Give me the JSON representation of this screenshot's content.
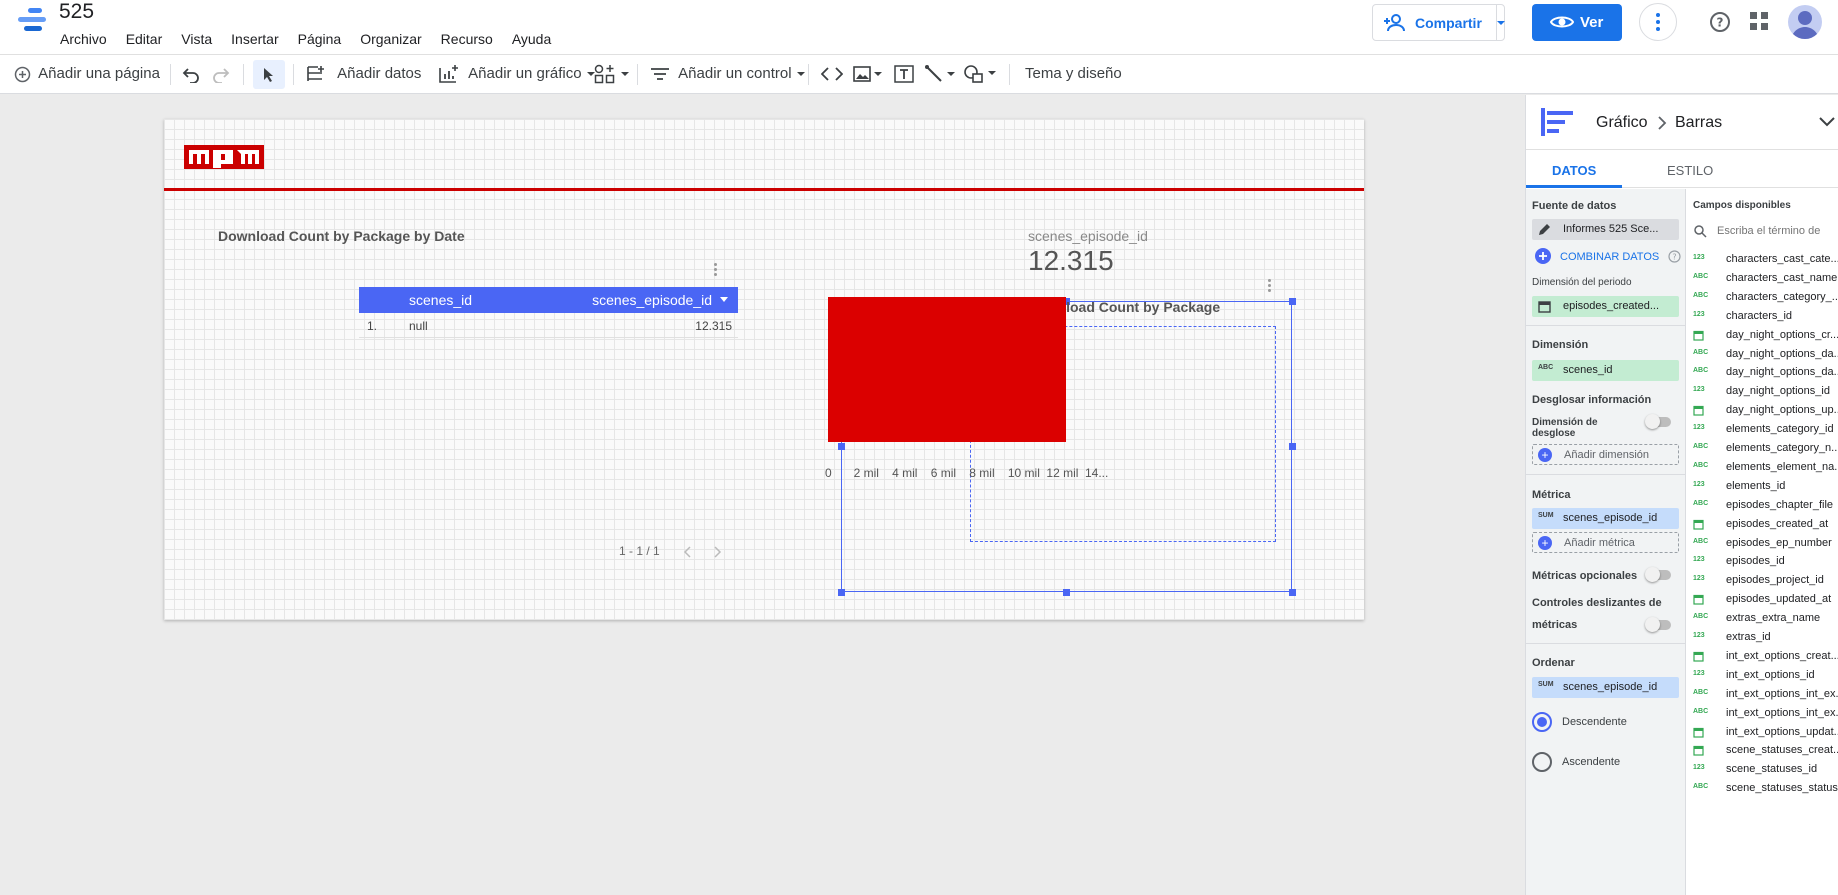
{
  "header": {
    "doc_title": "525",
    "menu": [
      "Archivo",
      "Editar",
      "Vista",
      "Insertar",
      "Página",
      "Organizar",
      "Recurso",
      "Ayuda"
    ],
    "share_label": "Compartir",
    "view_label": "Ver",
    "accent_color": "#1a73e8"
  },
  "toolbar": {
    "add_page": "Añadir una página",
    "add_data": "Añadir datos",
    "add_chart": "Añadir un gráfico",
    "add_control": "Añadir un control",
    "theme": "Tema y diseño"
  },
  "report": {
    "logo_text": "npm",
    "table_chart": {
      "title": "Download Count by Package by Date",
      "columns": [
        "scenes_id",
        "scenes_episode_id"
      ],
      "rows": [
        {
          "index": "1.",
          "scenes_id": "null",
          "scenes_episode_id": "12.315"
        }
      ],
      "pager": "1 - 1 / 1"
    },
    "scorecard": {
      "label": "scenes_episode_id",
      "value": "12.315"
    },
    "bar_chart": {
      "title": "Download Count by Package",
      "bar_color": "#db0000"
    }
  },
  "chart_data": {
    "type": "bar",
    "title": "Download Count by Package",
    "orientation": "horizontal",
    "categories": [
      ""
    ],
    "values": [
      12315
    ],
    "xlim": [
      0,
      14000
    ],
    "x_ticks": [
      "0",
      "2 mil",
      "4 mil",
      "6 mil",
      "8 mil",
      "10 mil",
      "12 mil",
      "14..."
    ],
    "color": "#db0000",
    "grid": false
  },
  "panel": {
    "breadcrumb_root": "Gráfico",
    "breadcrumb_leaf": "Barras",
    "tab_data": "DATOS",
    "tab_style": "ESTILO",
    "data_source_label": "Fuente de datos",
    "data_source_value": "Informes 525 Sce...",
    "blend_label": "COMBINAR DATOS",
    "period_label": "Dimensión del periodo",
    "period_value": "episodes_created...",
    "dimension_label": "Dimensión",
    "dimension_value": "scenes_id",
    "drill_label": "Desglosar información",
    "drill_dim_label": "Dimensión de desglose",
    "add_dimension": "Añadir dimensión",
    "metric_label": "Métrica",
    "metric_value": "scenes_episode_id",
    "add_metric": "Añadir métrica",
    "optional_metrics": "Métricas opcionales",
    "sliders_label_1": "Controles deslizantes de",
    "sliders_label_2": "métricas",
    "sort_label": "Ordenar",
    "sort_value": "scenes_episode_id",
    "desc_label": "Descendente",
    "asc_label": "Ascendente",
    "fields_label": "Campos disponibles",
    "search_placeholder": "Escriba el término de",
    "fields": [
      {
        "type": "123",
        "name": "characters_cast_cate..."
      },
      {
        "type": "ABC",
        "name": "characters_cast_name"
      },
      {
        "type": "ABC",
        "name": "characters_category_..."
      },
      {
        "type": "123",
        "name": "characters_id"
      },
      {
        "type": "date",
        "name": "day_night_options_cr..."
      },
      {
        "type": "ABC",
        "name": "day_night_options_da..."
      },
      {
        "type": "ABC",
        "name": "day_night_options_da..."
      },
      {
        "type": "123",
        "name": "day_night_options_id"
      },
      {
        "type": "date",
        "name": "day_night_options_up..."
      },
      {
        "type": "123",
        "name": "elements_category_id"
      },
      {
        "type": "ABC",
        "name": "elements_category_n..."
      },
      {
        "type": "ABC",
        "name": "elements_element_na..."
      },
      {
        "type": "123",
        "name": "elements_id"
      },
      {
        "type": "ABC",
        "name": "episodes_chapter_file"
      },
      {
        "type": "date",
        "name": "episodes_created_at"
      },
      {
        "type": "ABC",
        "name": "episodes_ep_number"
      },
      {
        "type": "123",
        "name": "episodes_id"
      },
      {
        "type": "123",
        "name": "episodes_project_id"
      },
      {
        "type": "date",
        "name": "episodes_updated_at"
      },
      {
        "type": "ABC",
        "name": "extras_extra_name"
      },
      {
        "type": "123",
        "name": "extras_id"
      },
      {
        "type": "date",
        "name": "int_ext_options_creat..."
      },
      {
        "type": "123",
        "name": "int_ext_options_id"
      },
      {
        "type": "ABC",
        "name": "int_ext_options_int_ex..."
      },
      {
        "type": "ABC",
        "name": "int_ext_options_int_ex..."
      },
      {
        "type": "date",
        "name": "int_ext_options_updat..."
      },
      {
        "type": "date",
        "name": "scene_statuses_creat..."
      },
      {
        "type": "123",
        "name": "scene_statuses_id"
      },
      {
        "type": "ABC",
        "name": "scene_statuses_status"
      }
    ]
  }
}
